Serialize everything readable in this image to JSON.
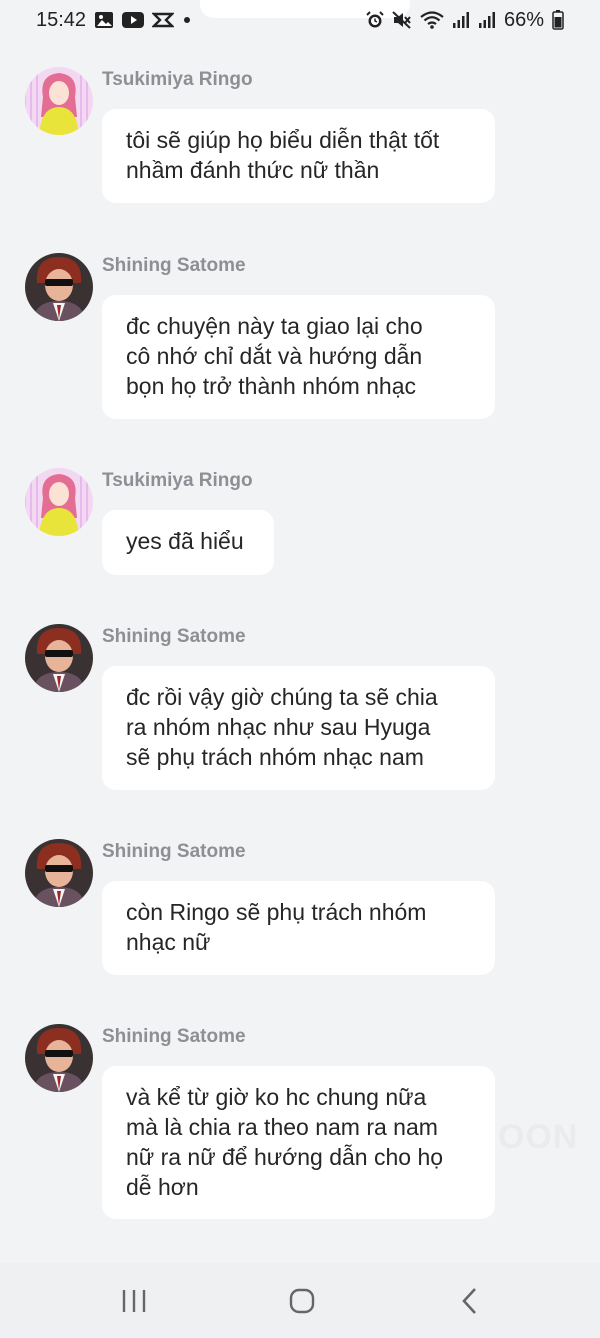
{
  "status_bar": {
    "time": "15:42",
    "battery": "66%",
    "left_icons": [
      "gallery-icon",
      "youtube-icon",
      "capcut-icon",
      "dot-icon"
    ],
    "right_icons": [
      "alarm-icon",
      "mute-icon",
      "wifi-icon",
      "signal-icon",
      "signal-icon",
      "battery-icon"
    ]
  },
  "messages": [
    {
      "sender": "Tsukimiya Ringo",
      "avatar": "ringo-avatar",
      "text": "tôi sẽ giúp họ biểu diễn thật tốt\nnhầm đánh thức nữ thần"
    },
    {
      "sender": "Shining Satome",
      "avatar": "satome-avatar",
      "text": "đc chuyện này ta giao lại cho\ncô nhớ chỉ dắt và hướng dẫn\nbọn họ trở thành nhóm nhạc"
    },
    {
      "sender": "Tsukimiya Ringo",
      "avatar": "ringo-avatar",
      "text": "yes đã hiểu"
    },
    {
      "sender": "Shining Satome",
      "avatar": "satome-avatar",
      "text": "đc rồi vậy giờ chúng ta sẽ chia\nra nhóm nhạc như sau Hyuga\nsẽ phụ trách nhóm nhạc nam"
    },
    {
      "sender": "Shining Satome",
      "avatar": "satome-avatar",
      "text": "còn Ringo sẽ phụ trách nhóm\nnhạc nữ"
    },
    {
      "sender": "Shining Satome",
      "avatar": "satome-avatar",
      "text": "và kể từ giờ ko hc chung nữa\nmà là chia ra theo nam ra nam\nnữ ra nữ để hướng dẫn cho họ\ndễ hơn"
    }
  ],
  "watermark": "OON",
  "nav_bar": {
    "recents": "recents-icon",
    "home": "home-icon",
    "back": "back-icon"
  }
}
